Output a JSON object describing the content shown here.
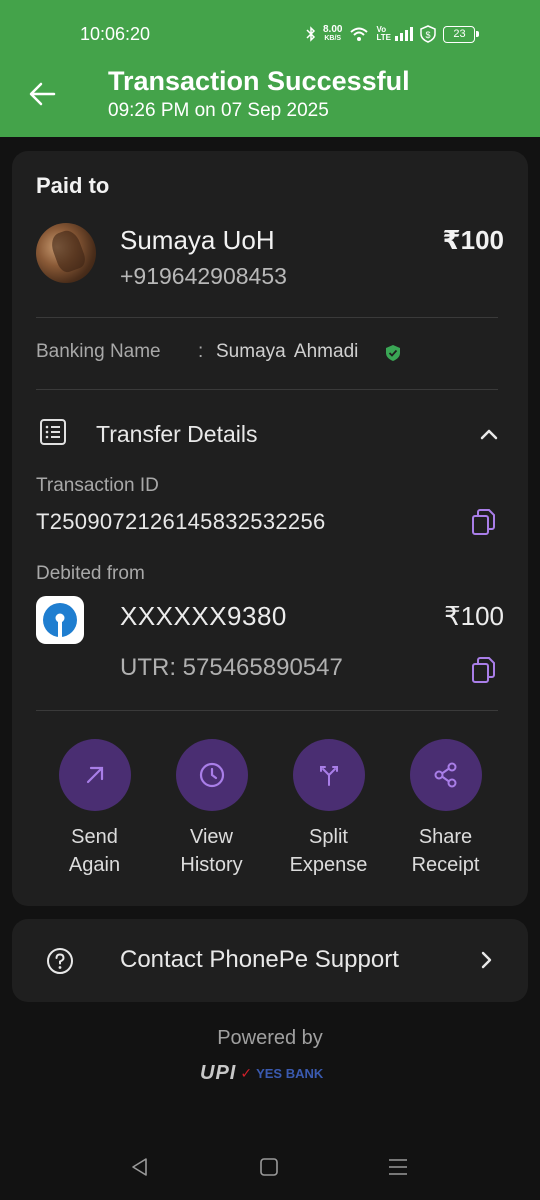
{
  "status_bar": {
    "time": "10:06:20",
    "speed_value": "8.00",
    "speed_unit": "KB/S",
    "volte": "Vo LTE",
    "battery": "23"
  },
  "header": {
    "title": "Transaction Successful",
    "subtitle": "09:26 PM on 07 Sep 2025",
    "bg_color": "#44a34a"
  },
  "payment": {
    "paid_to_label": "Paid to",
    "payee_name": "Sumaya UoH",
    "payee_phone": "+919642908453",
    "amount": "₹100",
    "banking_name_label": "Banking Name",
    "banking_name_colon": ":",
    "banking_name_value": "Sumaya  Ahmadi"
  },
  "transfer_details": {
    "label": "Transfer Details",
    "transaction_id_label": "Transaction ID",
    "transaction_id": "T2509072126145832532256",
    "debited_from_label": "Debited from",
    "account": "XXXXXX9380",
    "amount": "₹100",
    "utr": "UTR: 575465890547"
  },
  "actions": [
    {
      "line1": "Send",
      "line2": "Again",
      "icon": "arrow-up-right-icon"
    },
    {
      "line1": "View",
      "line2": "History",
      "icon": "clock-icon"
    },
    {
      "line1": "Split",
      "line2": "Expense",
      "icon": "split-icon"
    },
    {
      "line1": "Share",
      "line2": "Receipt",
      "icon": "share-icon"
    }
  ],
  "support": {
    "label": "Contact PhonePe Support"
  },
  "footer": {
    "powered_by": "Powered by",
    "upi": "UPI",
    "bank": "YES BANK"
  },
  "colors": {
    "accent_purple": "#4a2e72",
    "icon_purple": "#a97ee8",
    "verified_green": "#3aa655"
  }
}
